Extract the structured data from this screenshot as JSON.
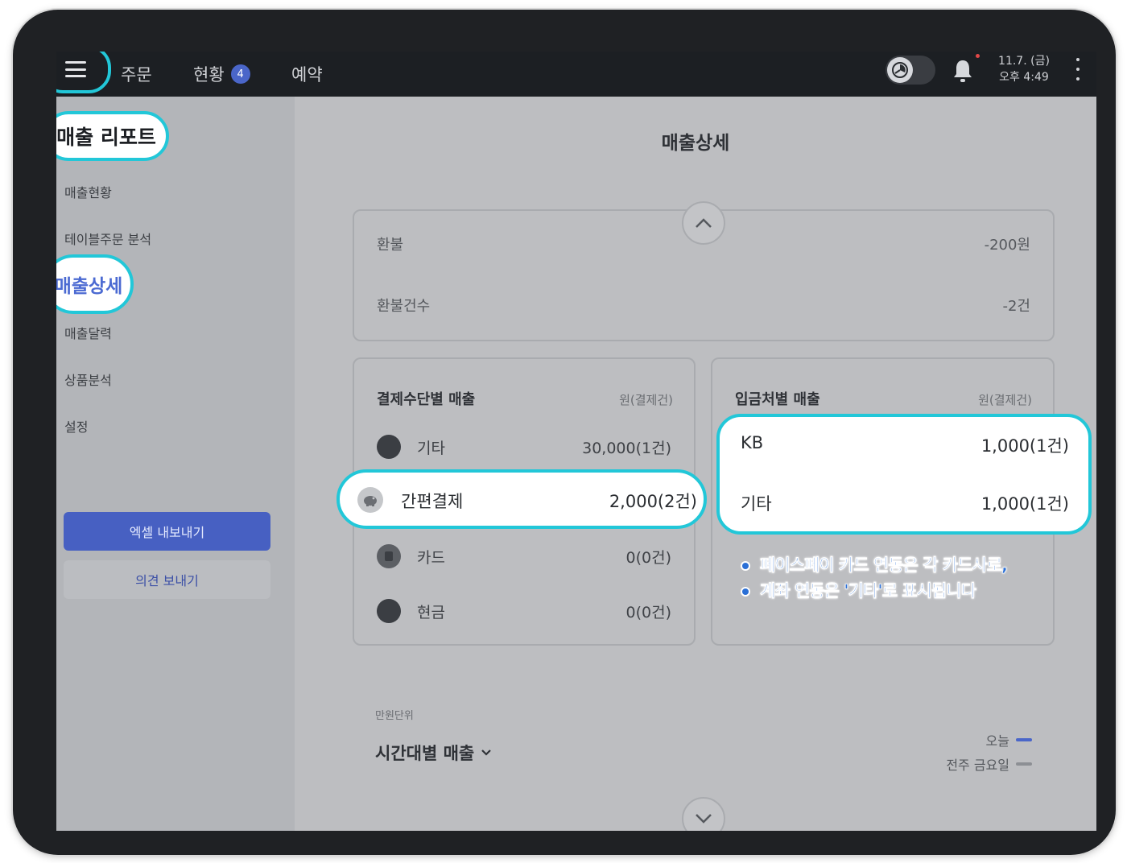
{
  "topbar": {
    "nav_order": "주문",
    "nav_status": "현황",
    "status_badge": "4",
    "nav_reserve": "예약",
    "date": "11.7. (금)",
    "time": "오후 4:49",
    "icons": [
      "menu-icon",
      "clock-icon",
      "bell-icon",
      "more-vertical-icon"
    ]
  },
  "sidebar": {
    "title": "매출 리포트",
    "items": [
      "매출현황",
      "테이블주문 분석",
      "매출상세",
      "매출달력",
      "상품분석",
      "설정"
    ],
    "active_item": "매출상세",
    "excel_button": "엑셀 내보내기",
    "feedback_button": "의견 보내기"
  },
  "main": {
    "page_title": "매출상세",
    "refund": {
      "rows": [
        {
          "label": "환불",
          "value": "-200원"
        },
        {
          "label": "환불건수",
          "value": "-2건"
        }
      ]
    },
    "payment_sales": {
      "title": "결제수단별 매출",
      "unit": "원(결제건)",
      "rows": [
        {
          "label": "기타",
          "value": "30,000(1건)"
        },
        {
          "label": "간편결제",
          "value": "2,000(2건)"
        },
        {
          "label": "카드",
          "value": "0(0건)"
        },
        {
          "label": "현금",
          "value": "0(0건)"
        }
      ]
    },
    "deposit_sales": {
      "title": "입금처별 매출",
      "unit": "원(결제건)",
      "rows": [
        {
          "label": "KB",
          "value": "1,000(1건)"
        },
        {
          "label": "기타",
          "value": "1,000(1건)"
        }
      ]
    },
    "notes": [
      "페이스페이 카드 연동은 각 카드사로,",
      "계좌 연동은 '기타'로 표시됩니다"
    ],
    "hourly": {
      "unit": "만원단위",
      "title": "시간대별 매출",
      "legend": [
        {
          "label": "오늘",
          "color": "#4a66c9"
        },
        {
          "label": "전주 금요일",
          "color": "#8c8f94"
        }
      ]
    }
  },
  "colors": {
    "highlight": "#22c7d8",
    "accent": "#4a66c9",
    "note": "#2a6fd6"
  }
}
